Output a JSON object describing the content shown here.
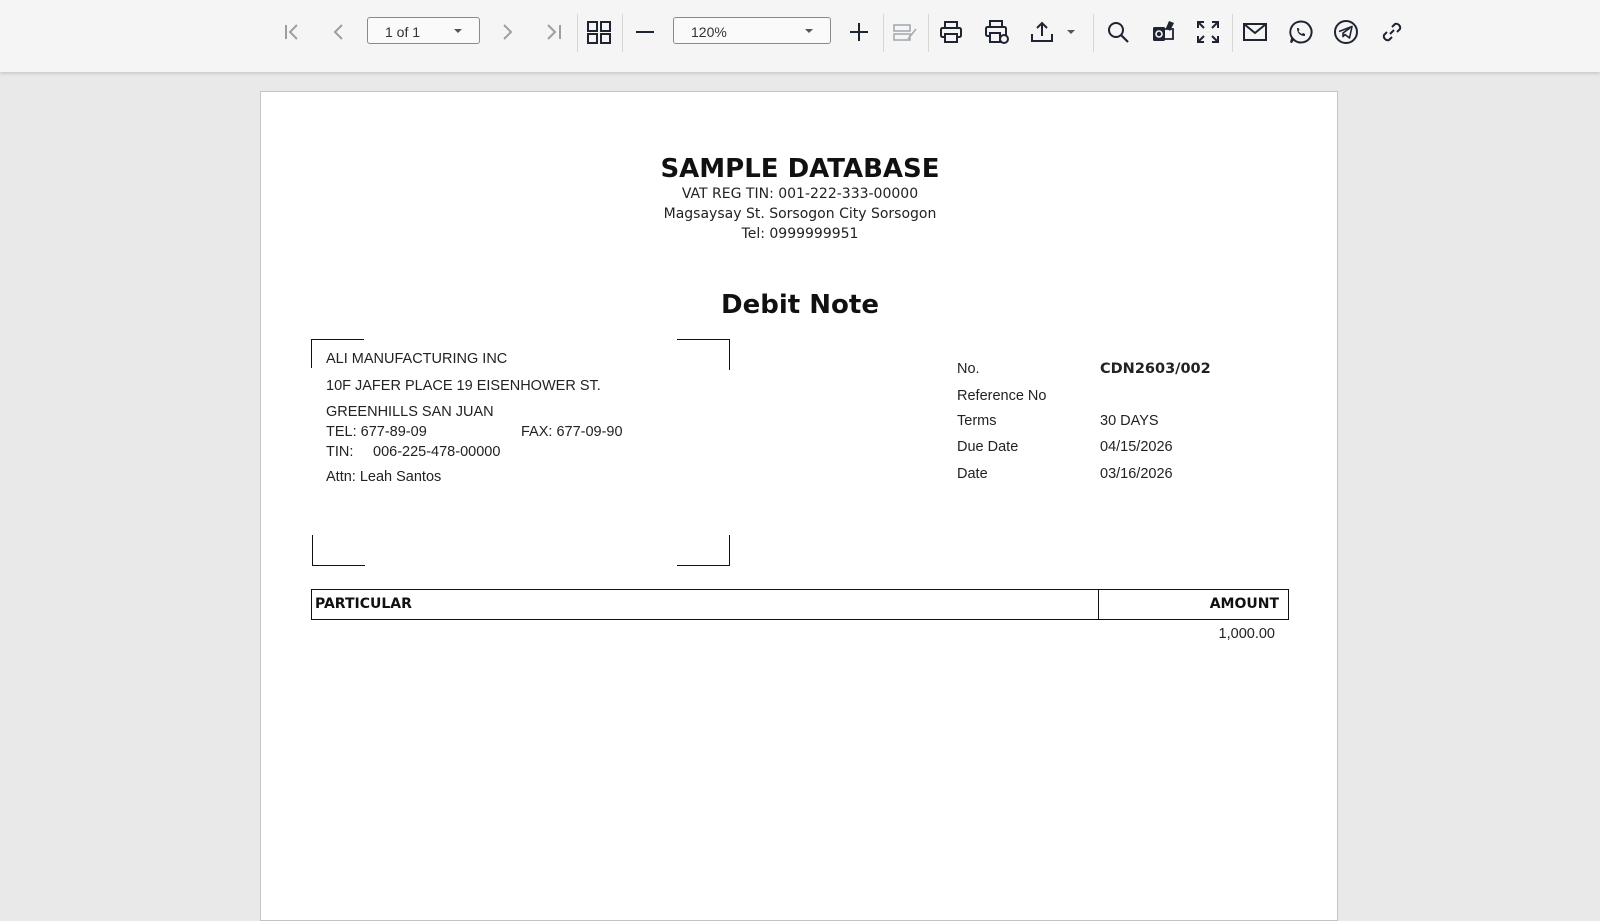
{
  "toolbar": {
    "page_indicator": "1 of 1",
    "zoom": "120%"
  },
  "document": {
    "company_name": "SAMPLE DATABASE",
    "vat_reg": "VAT REG TIN: 001-222-333-00000",
    "company_address": "Magsaysay St. Sorsogon City Sorsogon",
    "company_tel": "Tel: 0999999951",
    "title": "Debit Note",
    "customer": {
      "name": "ALI MANUFACTURING INC",
      "address1": "10F JAFER PLACE 19 EISENHOWER ST.",
      "address2": "GREENHILLS SAN JUAN",
      "tel": "TEL: 677-89-09",
      "fax": "FAX: 677-09-90",
      "tin_label": "TIN:",
      "tin": "006-225-478-00000",
      "attn": "Attn: Leah Santos"
    },
    "meta": [
      {
        "label": "No.",
        "value": "CDN2603/002"
      },
      {
        "label": "Reference No",
        "value": ""
      },
      {
        "label": "Terms",
        "value": "30 DAYS"
      },
      {
        "label": "Due Date",
        "value": "04/15/2026"
      },
      {
        "label": "Date",
        "value": "03/16/2026"
      }
    ],
    "table": {
      "headers": [
        "PARTICULAR",
        "AMOUNT"
      ],
      "rows": [
        {
          "particular": "",
          "amount": "1,000.00"
        }
      ]
    }
  }
}
